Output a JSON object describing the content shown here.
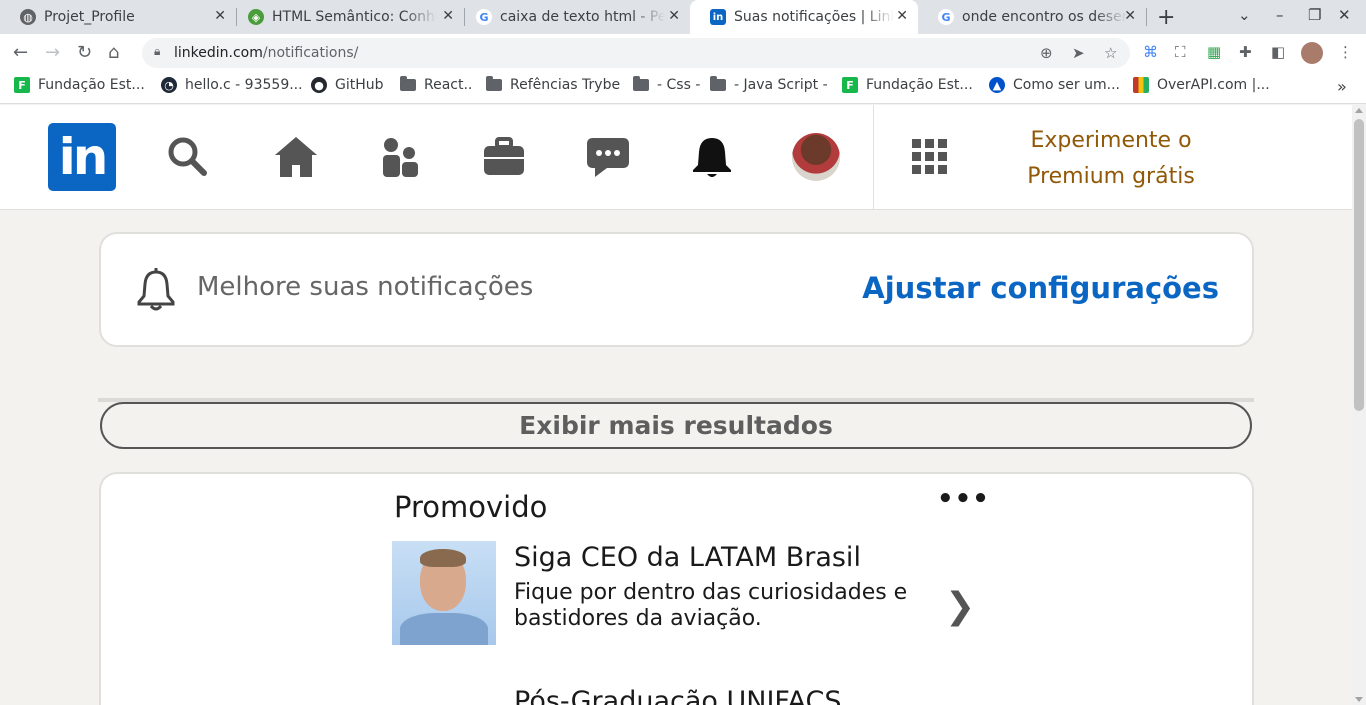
{
  "browser": {
    "tabs": [
      {
        "title": "Projet_Profile",
        "icon": "globe-icon",
        "active": false
      },
      {
        "title": "HTML Semântico: Conheça",
        "icon": "alura-icon",
        "active": false
      },
      {
        "title": "caixa de texto html - Pesquisa",
        "icon": "google-icon",
        "active": false
      },
      {
        "title": "Suas notificações | LinkedIn",
        "icon": "linkedin-icon",
        "active": true
      },
      {
        "title": "onde encontro os desenhos",
        "icon": "google-icon",
        "active": false
      }
    ],
    "url_host": "linkedin.com",
    "url_path": "/notifications/",
    "bookmarks": [
      {
        "label": "Fundação Est...",
        "icon": "green-square-icon"
      },
      {
        "label": "hello.c - 93559...",
        "icon": "replit-icon"
      },
      {
        "label": "GitHub",
        "icon": "github-icon"
      },
      {
        "label": "React..",
        "icon": "folder-icon"
      },
      {
        "label": "Refências Trybe",
        "icon": "folder-icon"
      },
      {
        "label": "- Css -",
        "icon": "folder-icon"
      },
      {
        "label": "- Java Script -",
        "icon": "folder-icon"
      },
      {
        "label": "Fundação Est...",
        "icon": "green-square-icon"
      },
      {
        "label": "Como ser um...",
        "icon": "atlassian-icon"
      },
      {
        "label": "OverAPI.com |...",
        "icon": "overapi-icon"
      }
    ],
    "bookmarks_overflow": "»"
  },
  "linkedin": {
    "logo_text": "in",
    "premium_line1": "Experimente o",
    "premium_line2": "Premium grátis",
    "improve_text": "Melhore suas notificações",
    "adjust_link": "Ajustar configurações",
    "show_more": "Exibir mais resultados",
    "promo": {
      "heading": "Promovido",
      "more": "•••",
      "title": "Siga CEO da LATAM Brasil",
      "description": "Fique por dentro das curiosidades e bastidores da aviação.",
      "chevron": "❯",
      "next_title": "Pós-Graduação UNIFACS"
    },
    "colors": {
      "brand": "#0a66c2",
      "premium": "#915907",
      "background": "#f3f2ef"
    }
  }
}
